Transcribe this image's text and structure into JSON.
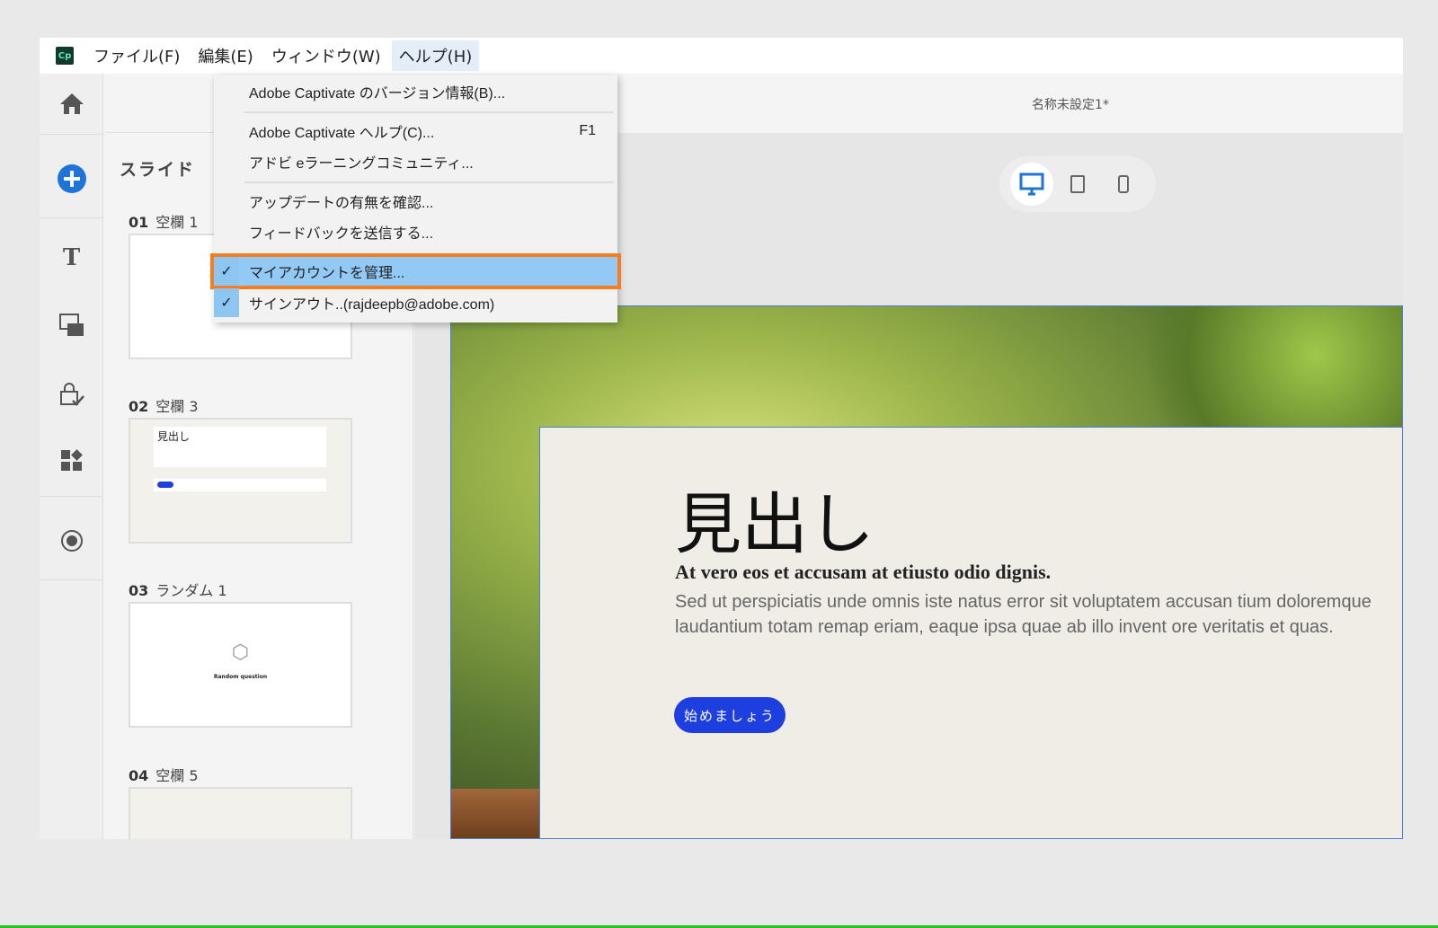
{
  "menubar": {
    "logo": "Cp",
    "items": [
      "ファイル(F)",
      "編集(E)",
      "ウィンドウ(W)",
      "ヘルプ(H)"
    ]
  },
  "help_menu": {
    "about": "Adobe Captivate のバージョン情報(B)...",
    "help": "Adobe Captivate ヘルプ(C)...",
    "help_key": "F1",
    "community": "アドビ eラーニングコミュニティ...",
    "updates": "アップデートの有無を確認...",
    "feedback": "フィードバックを送信する...",
    "manage_account": "マイアカウントを管理...",
    "sign_out": "サインアウト..(rajdeepb@adobe.com)",
    "check": "✓"
  },
  "document": {
    "title": "名称未設定1*"
  },
  "slides_panel": {
    "title": "スライド",
    "slides": [
      {
        "num": "01",
        "name": "空欄 1"
      },
      {
        "num": "02",
        "name": "空欄 3",
        "thumb_heading": "見出し"
      },
      {
        "num": "03",
        "name": "ランダム 1",
        "thumb_heading": "Random question"
      },
      {
        "num": "04",
        "name": "空欄 5"
      }
    ]
  },
  "slide": {
    "heading": "見出し",
    "subheading": "At vero eos et accusam at etiusto odio dignis.",
    "body": "Sed ut perspiciatis unde omnis iste natus error sit voluptatem accusan tium doloremque laudantium totam remap eriam, eaque ipsa quae ab illo invent ore veritatis et quas.",
    "button": "始めましょう"
  },
  "colors": {
    "accent": "#1d3fe0",
    "highlight": "#f47d20",
    "selection": "#92c9f5"
  }
}
